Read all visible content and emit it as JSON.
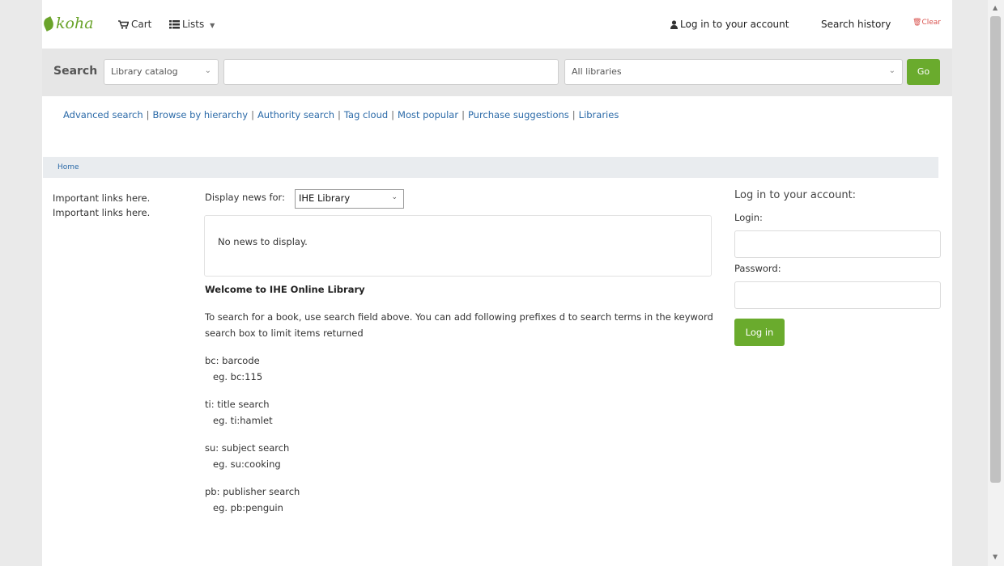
{
  "header": {
    "logo": "koha",
    "cart_label": "Cart",
    "lists_label": "Lists",
    "login_link": "Log in to your account",
    "search_history": "Search history",
    "clear": "Clear"
  },
  "search": {
    "label": "Search",
    "catalog_value": "Library catalog",
    "query_value": "",
    "libraries_value": "All libraries",
    "go_label": "Go"
  },
  "more_searches": [
    "Advanced search",
    "Browse by hierarchy",
    "Authority search",
    "Tag cloud",
    "Most popular",
    "Purchase suggestions",
    "Libraries"
  ],
  "breadcrumb": {
    "home": "Home"
  },
  "left": {
    "links": [
      "Important links here.",
      "Important links here."
    ]
  },
  "news": {
    "label": "Display news for:",
    "selected": "IHE Library",
    "empty": "No news to display."
  },
  "main": {
    "heading": "Welcome to IHE Online Library",
    "intro": "To search for a book, use search field above. You can add following prefixes d to search terms in the keyword search box to limit items returned",
    "prefixes": [
      {
        "name": "bc: barcode",
        "eg": "eg. bc:115"
      },
      {
        "name": "ti: title search",
        "eg": "eg. ti:hamlet"
      },
      {
        "name": "su: subject search",
        "eg": "eg. su:cooking"
      },
      {
        "name": "pb: publisher search",
        "eg": "eg. pb:penguin"
      }
    ]
  },
  "login": {
    "title": "Log in to your account:",
    "login_label": "Login:",
    "password_label": "Password:",
    "button": "Log in"
  }
}
